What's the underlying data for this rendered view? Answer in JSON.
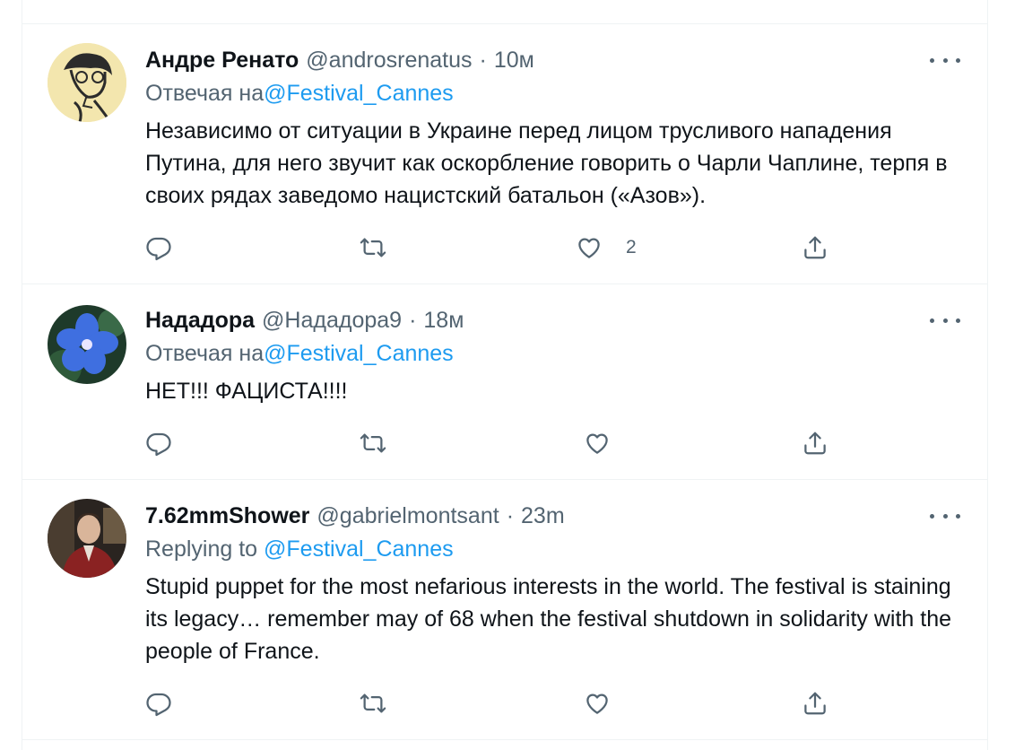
{
  "tweets": [
    {
      "display_name": "Андре Ренато",
      "handle": "@androsrenatus",
      "time": "10м",
      "replying_prefix": "Отвечая на",
      "replying_to": "@Festival_Cannes",
      "text": "Независимо от ситуации в Украине перед лицом трусливого нападения Путина, для него звучит как оскорбление говорить о Чарли Чаплине, терпя в своих рядах заведомо нацистский батальон («Азов»).",
      "like_count": "2",
      "avatar": "sketch-portrait"
    },
    {
      "display_name": "Нададора",
      "handle": "@Нададора9",
      "time": "18м",
      "replying_prefix": "Отвечая на",
      "replying_to": "@Festival_Cannes",
      "text": "НЕТ!!! ФАЦИСТА!!!!",
      "like_count": "",
      "avatar": "blue-flower"
    },
    {
      "display_name": "7.62mmShower",
      "handle": "@gabrielmontsant",
      "time": "23m",
      "replying_prefix": "Replying to",
      "replying_to": "@Festival_Cannes",
      "text": "Stupid puppet for the most nefarious interests in the world. The festival is staining its legacy… remember may of 68 when the festival shutdown in solidarity with the people of France.",
      "like_count": "",
      "avatar": "person-photo"
    }
  ],
  "separator": "·",
  "icons": [
    "more-icon",
    "reply-icon",
    "retweet-icon",
    "like-icon",
    "share-icon"
  ],
  "colors": {
    "link": "#1d9bf0",
    "secondary": "#536471",
    "text": "#0f1419",
    "border": "#eff3f4"
  }
}
